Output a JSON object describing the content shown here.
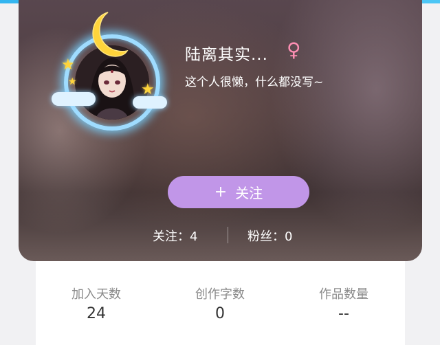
{
  "profile": {
    "username": "陆离其实...",
    "gender_icon": "♀",
    "bio": "这个人很懒，什么都没写~",
    "follow_button": {
      "icon": "+",
      "label": "关注"
    },
    "following": {
      "label": "关注：",
      "value": "4"
    },
    "followers": {
      "label": "粉丝：",
      "value": "0"
    }
  },
  "stats": [
    {
      "label": "加入天数",
      "value": "24"
    },
    {
      "label": "创作字数",
      "value": "0"
    },
    {
      "label": "作品数量",
      "value": "--"
    }
  ],
  "colors": {
    "accent": "#c196e8",
    "topbar": "#33b5f0",
    "gender": "#ff8fb4"
  },
  "icons": {
    "gender": "female-symbol-icon",
    "avatar_decor": [
      "moon-icon",
      "star-icon",
      "cloud-icon"
    ]
  }
}
